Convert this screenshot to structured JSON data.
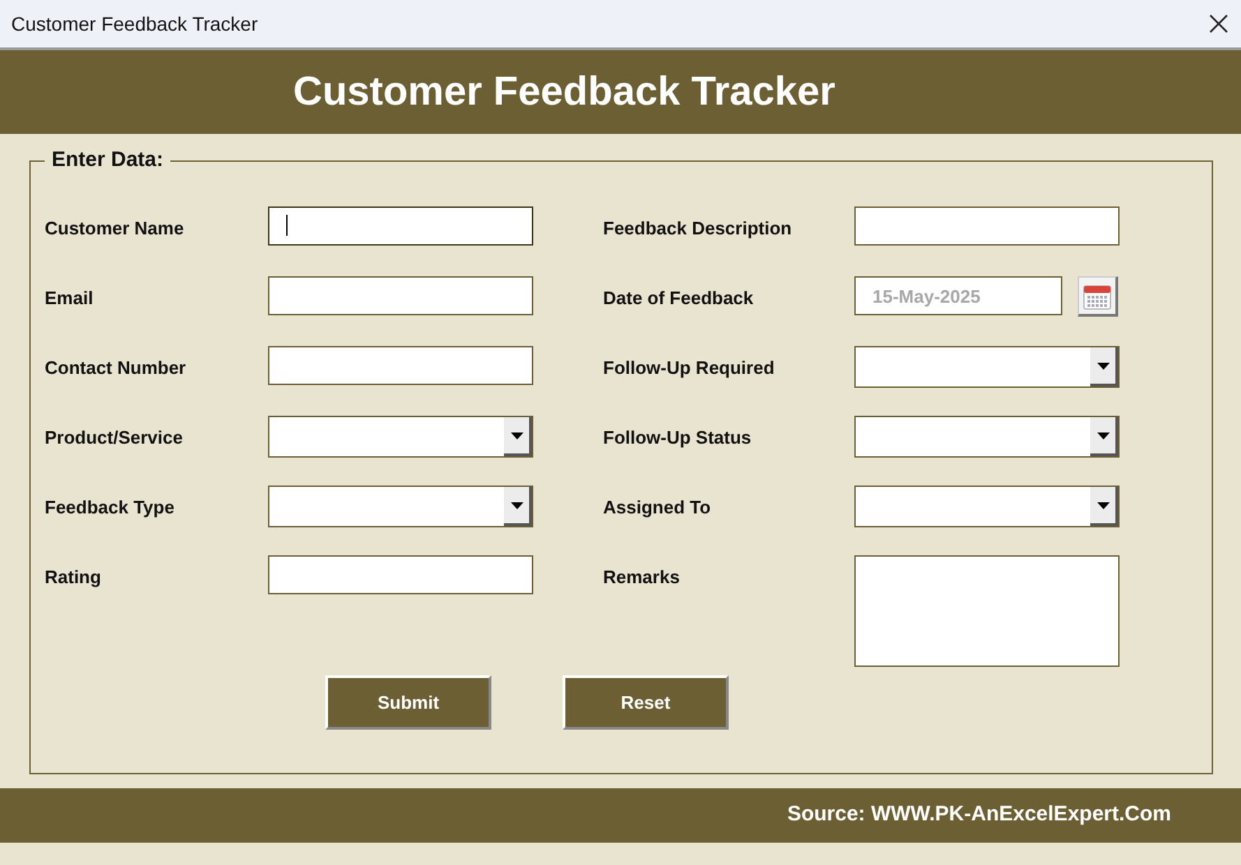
{
  "window": {
    "title": "Customer Feedback Tracker"
  },
  "header": {
    "title": "Customer Feedback Tracker"
  },
  "form": {
    "legend": "Enter Data:",
    "left": [
      {
        "label": "Customer Name",
        "kind": "text",
        "focused": true
      },
      {
        "label": "Email",
        "kind": "text",
        "focused": false
      },
      {
        "label": "Contact Number",
        "kind": "text",
        "focused": false
      },
      {
        "label": "Product/Service",
        "kind": "dropdown",
        "focused": false
      },
      {
        "label": "Feedback Type",
        "kind": "dropdown",
        "focused": false
      },
      {
        "label": "Rating",
        "kind": "text",
        "focused": false
      }
    ],
    "right": [
      {
        "label": "Feedback Description",
        "kind": "text",
        "focused": false
      },
      {
        "label": "Date of Feedback",
        "kind": "date",
        "value": "15-May-2025",
        "disabled": true,
        "focused": false
      },
      {
        "label": "Follow-Up Required",
        "kind": "dropdown",
        "focused": false
      },
      {
        "label": "Follow-Up Status",
        "kind": "dropdown",
        "focused": false
      },
      {
        "label": "Assigned To",
        "kind": "dropdown",
        "focused": false
      },
      {
        "label": "Remarks",
        "kind": "memo",
        "focused": false
      }
    ],
    "buttons": [
      "Submit",
      "Reset"
    ]
  },
  "footer": {
    "source": "Source: WWW.PK-AnExcelExpert.Com"
  }
}
